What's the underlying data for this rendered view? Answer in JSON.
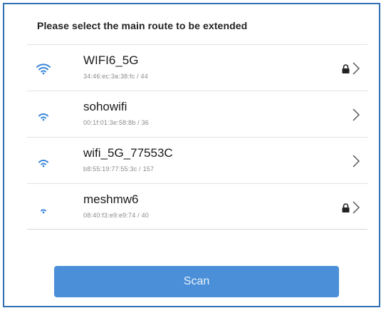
{
  "header": {
    "title": "Please select the main route to be extended"
  },
  "networks": [
    {
      "ssid": "WIFI6_5G",
      "detail": "34:46:ec:3a:38:fc / 44",
      "signal": 3,
      "secured": true
    },
    {
      "ssid": "sohowifi",
      "detail": "00:1f:01:3e:58:8b / 36",
      "signal": 2,
      "secured": false
    },
    {
      "ssid": "wifi_5G_77553C",
      "detail": "b8:55:19:77:55:3c / 157",
      "signal": 2,
      "secured": false
    },
    {
      "ssid": "meshmw6",
      "detail": "08:40:f3:e9:e9:74 / 40",
      "signal": 1,
      "secured": true
    }
  ],
  "icons": {
    "wifi": "wifi-signal-icon",
    "lock": "lock-icon",
    "chevron": "chevron-right-icon"
  },
  "colors": {
    "accent": "#4a8fd7",
    "wifi": "#3b86d8",
    "frame": "#2f6fb3"
  },
  "scan_button": {
    "label": "Scan"
  }
}
